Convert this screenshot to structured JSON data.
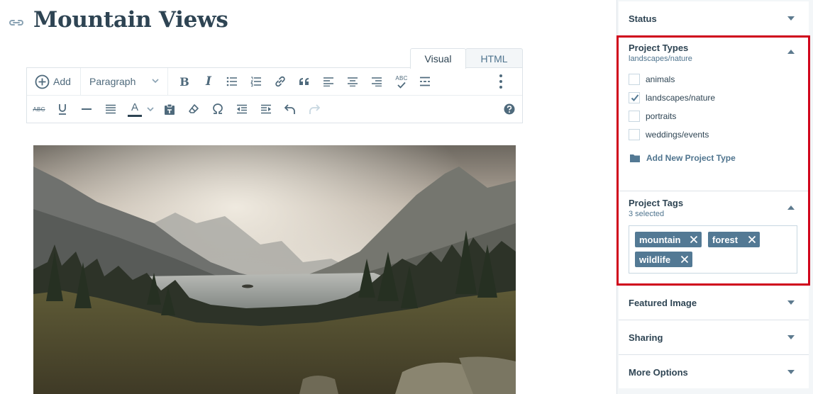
{
  "post": {
    "title": "Mountain Views"
  },
  "editor": {
    "tabs": [
      {
        "label": "Visual",
        "active": true
      },
      {
        "label": "HTML",
        "active": false
      }
    ],
    "toolbar": {
      "add_label": "Add",
      "format_value": "Paragraph",
      "row1_icons": [
        "add-media-icon",
        "bold-icon",
        "italic-icon",
        "bulleted-list-icon",
        "numbered-list-icon",
        "link-icon",
        "blockquote-icon",
        "align-left-icon",
        "align-center-icon",
        "align-right-icon",
        "spellcheck-icon",
        "read-more-icon",
        "more-options-icon"
      ],
      "row2_icons": [
        "strikethrough-icon",
        "underline-icon",
        "horizontal-rule-icon",
        "justify-icon",
        "text-color-icon",
        "paste-text-icon",
        "clear-formatting-icon",
        "special-character-icon",
        "outdent-icon",
        "indent-icon",
        "undo-icon",
        "redo-icon",
        "help-icon"
      ],
      "text_color_letter": "A",
      "spellcheck_letters": "ABC",
      "strike_letters": "ABC"
    }
  },
  "sidebar": {
    "status": {
      "label": "Status"
    },
    "project_types": {
      "label": "Project Types",
      "summary": "landscapes/nature",
      "options": [
        {
          "label": "animals",
          "checked": false
        },
        {
          "label": "landscapes/nature",
          "checked": true
        },
        {
          "label": "portraits",
          "checked": false
        },
        {
          "label": "weddings/events",
          "checked": false
        }
      ],
      "add_label": "Add New Project Type"
    },
    "project_tags": {
      "label": "Project Tags",
      "summary": "3 selected",
      "tags": [
        "mountain",
        "forest",
        "wildlife"
      ]
    },
    "featured_image": {
      "label": "Featured Image"
    },
    "sharing": {
      "label": "Sharing"
    },
    "more_options": {
      "label": "More Options"
    }
  },
  "colors": {
    "accent": "#537994",
    "text": "#2e4453",
    "highlight": "#d0021b",
    "sidebar_bg": "#f3f6f8"
  }
}
